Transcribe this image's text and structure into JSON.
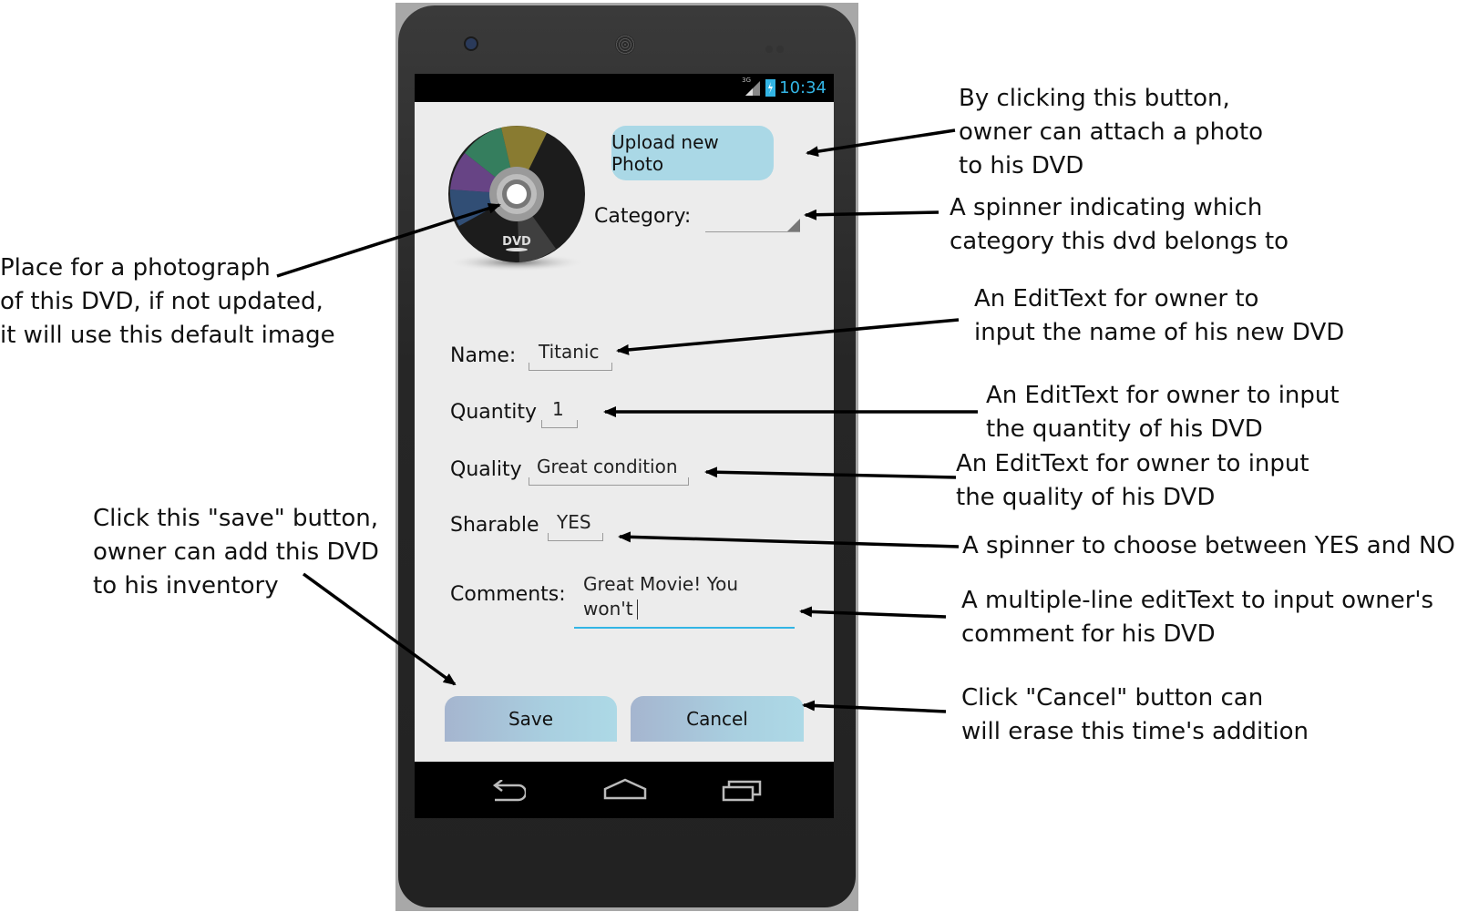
{
  "status_bar": {
    "network": "3G",
    "time": "10:34"
  },
  "form": {
    "upload_button": "Upload new Photo",
    "category_label": "Category:",
    "category_value": "",
    "name_label": "Name:",
    "name_value": "Titanic",
    "quantity_label": "Quantity",
    "quantity_value": "1",
    "quality_label": "Quality",
    "quality_value": "Great condition",
    "sharable_label": "Sharable",
    "sharable_value": "YES",
    "comments_label": "Comments:",
    "comments_line1": "Great Movie! You",
    "comments_line2": "won't",
    "save_button": "Save",
    "cancel_button": "Cancel",
    "dvd_logo_text": "DVD"
  },
  "annotations": {
    "upload": [
      "By clicking this button,",
      "owner can attach a photo",
      "to his DVD"
    ],
    "category": [
      "A spinner indicating which",
      "category this dvd belongs to"
    ],
    "photo": [
      "Place for a photograph",
      "of this DVD, if not updated,",
      "it will use this default image"
    ],
    "name": [
      "An EditText for owner to",
      "input the name of his new DVD"
    ],
    "quantity": [
      "An EditText for owner to input",
      "the quantity of his DVD"
    ],
    "quality": [
      "An EditText for owner to input",
      "the quality of his DVD"
    ],
    "sharable": [
      "A spinner to choose between YES and NO"
    ],
    "save": [
      "Click this \"save\" button,",
      "owner can add this DVD",
      "to his inventory"
    ],
    "comments": [
      "A multiple-line editText to input owner's",
      "comment for his DVD"
    ],
    "cancel": [
      "Click \"Cancel\" button can",
      "will erase this time's addition"
    ]
  },
  "colors": {
    "accent": "#33b5e5",
    "upload_button": "#aad8e6",
    "screen_bg": "#ececec",
    "phone_body": "#2a2a2a"
  }
}
